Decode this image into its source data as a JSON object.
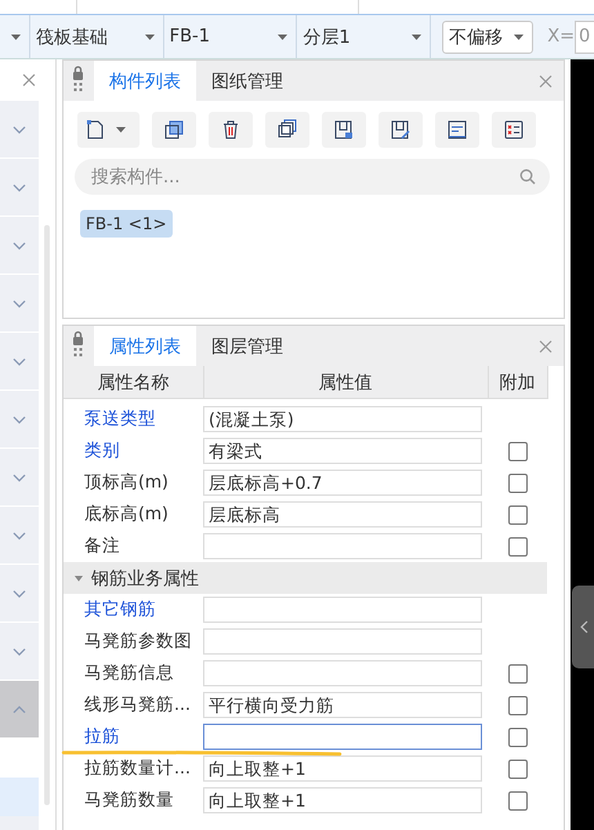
{
  "toolbar": {
    "combos": [
      {
        "value": "筏板基础"
      },
      {
        "value": "FB-1"
      },
      {
        "value": "分层1"
      }
    ],
    "offset_button": "不偏移",
    "x_label": "X=",
    "x_value": "0"
  },
  "sidebar": {
    "groups": [
      {
        "expanded": false
      },
      {
        "expanded": false
      },
      {
        "expanded": false
      },
      {
        "expanded": false
      },
      {
        "expanded": false
      },
      {
        "expanded": false
      },
      {
        "expanded": false
      },
      {
        "expanded": false
      },
      {
        "expanded": false
      },
      {
        "expanded": false
      },
      {
        "expanded": true
      }
    ],
    "items": [
      {
        "selected": false
      },
      {
        "selected": true
      }
    ]
  },
  "component_panel": {
    "tabs": [
      {
        "label": "构件列表",
        "selected": true
      },
      {
        "label": "图纸管理",
        "selected": false
      }
    ],
    "search": {
      "placeholder": "搜索构件..."
    },
    "items": [
      {
        "label": "FB-1 <1>",
        "selected": true
      }
    ]
  },
  "property_panel": {
    "tabs": [
      {
        "label": "属性列表",
        "selected": true
      },
      {
        "label": "图层管理",
        "selected": false
      }
    ],
    "columns": [
      "属性名称",
      "属性值",
      "附加"
    ],
    "rows": [
      {
        "kind": "prop",
        "name": "泵送类型",
        "link": true,
        "value": "(混凝土泵)",
        "focused": false
      },
      {
        "kind": "check",
        "name": "类别",
        "link": true,
        "value": "有梁式",
        "focused": false,
        "checked": false
      },
      {
        "kind": "check",
        "name": "顶标高(m)",
        "link": false,
        "value": "层底标高+0.7",
        "focused": false,
        "checked": false
      },
      {
        "kind": "check",
        "name": "底标高(m)",
        "link": false,
        "value": "层底标高",
        "focused": false,
        "checked": false
      },
      {
        "kind": "check",
        "name": "备注",
        "link": false,
        "value": "",
        "focused": false,
        "checked": false
      },
      {
        "kind": "section",
        "name": "钢筋业务属性",
        "expanded": true
      },
      {
        "kind": "prop",
        "name": "其它钢筋",
        "link": true,
        "value": "",
        "focused": false
      },
      {
        "kind": "prop",
        "name": "马凳筋参数图",
        "link": false,
        "value": "",
        "focused": false
      },
      {
        "kind": "check",
        "name": "马凳筋信息",
        "link": false,
        "value": "",
        "focused": false,
        "checked": false
      },
      {
        "kind": "check",
        "name": "线形马凳筋...",
        "link": false,
        "value": "平行横向受力筋",
        "focused": false,
        "checked": false
      },
      {
        "kind": "check",
        "name": "拉筋",
        "link": true,
        "value": "",
        "focused": true,
        "checked": false
      },
      {
        "kind": "check",
        "name": "拉筋数量计...",
        "link": false,
        "value": "向上取整+1",
        "focused": false,
        "checked": false
      },
      {
        "kind": "check",
        "name": "马凳筋数量",
        "link": false,
        "value": "向上取整+1",
        "focused": false,
        "checked": false
      }
    ]
  }
}
